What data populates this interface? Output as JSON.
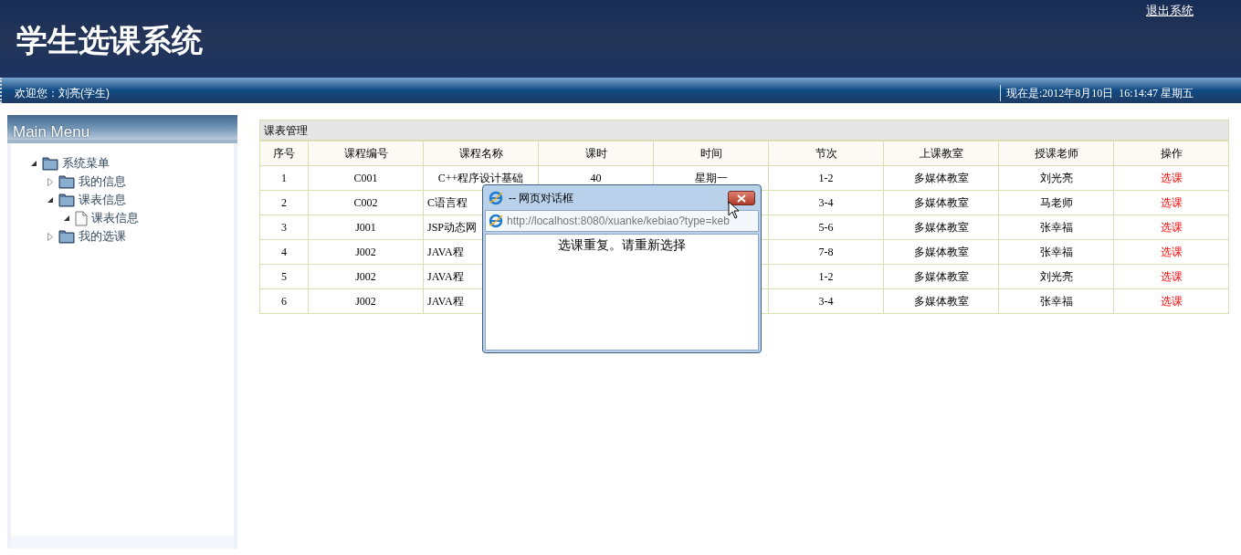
{
  "header": {
    "title": "学生选课系统",
    "logout_link": "退出系统"
  },
  "status_bar": {
    "welcome": "欢迎您：刘亮(学生)",
    "now": "现在是:2012年8月10日  16:14:47 星期五"
  },
  "sidebar": {
    "title": "Main Menu",
    "tree": [
      {
        "label": "系统菜单",
        "kind": "folder",
        "expanded": true,
        "children": [
          {
            "label": "我的信息",
            "kind": "folder",
            "expanded": false
          },
          {
            "label": "课表信息",
            "kind": "folder",
            "expanded": true,
            "children": [
              {
                "label": "课表信息",
                "kind": "page",
                "expanded": true
              }
            ]
          },
          {
            "label": "我的选课",
            "kind": "folder",
            "expanded": false
          }
        ]
      }
    ]
  },
  "table": {
    "title": "课表管理",
    "columns": [
      "序号",
      "课程编号",
      "课程名称",
      "课时",
      "时间",
      "节次",
      "上课教室",
      "授课老师",
      "操作"
    ],
    "rows": [
      {
        "no": "1",
        "code": "C001",
        "name": "C++程序设计基础",
        "hours": "40",
        "time": "星期一",
        "period": "1-2",
        "room": "多媒体教室",
        "teacher": "刘光亮",
        "action": "选课"
      },
      {
        "no": "2",
        "code": "C002",
        "name": "C语言程",
        "period": "3-4",
        "room": "多媒体教室",
        "teacher": "马老师",
        "action": "选课"
      },
      {
        "no": "3",
        "code": "J001",
        "name": "JSP动态网",
        "period": "5-6",
        "room": "多媒体教室",
        "teacher": "张幸福",
        "action": "选课"
      },
      {
        "no": "4",
        "code": "J002",
        "name": "JAVA程",
        "period": "7-8",
        "room": "多媒体教室",
        "teacher": "张幸福",
        "action": "选课"
      },
      {
        "no": "5",
        "code": "J002",
        "name": "JAVA程",
        "period": "1-2",
        "room": "多媒体教室",
        "teacher": "刘光亮",
        "action": "选课"
      },
      {
        "no": "6",
        "code": "J002",
        "name": "JAVA程",
        "period": "3-4",
        "room": "多媒体教室",
        "teacher": "张幸福",
        "action": "选课"
      }
    ]
  },
  "dialog": {
    "title": "-- 网页对话框",
    "url": "http://localhost:8080/xuanke/kebiao?type=keb",
    "message": "选课重复。请重新选择"
  }
}
